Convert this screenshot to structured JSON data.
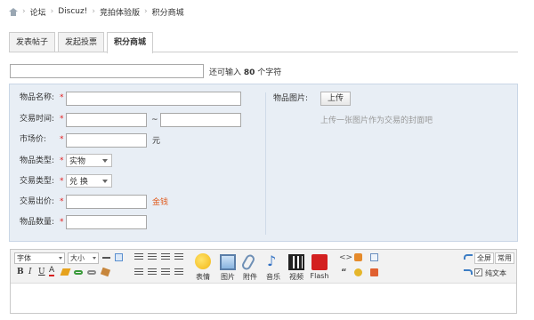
{
  "breadcrumb": {
    "items": [
      "论坛",
      "Discuz!",
      "竞拍体验版",
      "积分商城"
    ]
  },
  "tabs": [
    "发表帖子",
    "发起投票",
    "积分商城"
  ],
  "subject": {
    "value": "",
    "hint_prefix": "还可输入",
    "hint_count": "80",
    "hint_suffix": "个字符"
  },
  "form": {
    "name_label": "物品名称:",
    "time_label": "交易时间:",
    "time_sep": "~",
    "price_label": "市场价:",
    "price_unit": "元",
    "type_label": "物品类型:",
    "type_value": "实物",
    "trade_label": "交易类型:",
    "trade_value": "兑 换",
    "bid_label": "交易出价:",
    "bid_unit": "金钱",
    "qty_label": "物品数量:",
    "required_mark": "*",
    "image_label": "物品图片:",
    "upload_label": "上传",
    "upload_hint": "上传一张图片作为交易的封面吧"
  },
  "editor": {
    "font_select": "字体",
    "size_select": "大小",
    "format_buttons": [
      "B",
      "I",
      "U",
      "A"
    ],
    "big_tools": [
      "表情",
      "图片",
      "附件",
      "音乐",
      "视频",
      "Flash"
    ],
    "fullscreen_label": "全屏",
    "common_label": "常用",
    "plaintext_label": "纯文本",
    "plaintext_checked": true
  }
}
